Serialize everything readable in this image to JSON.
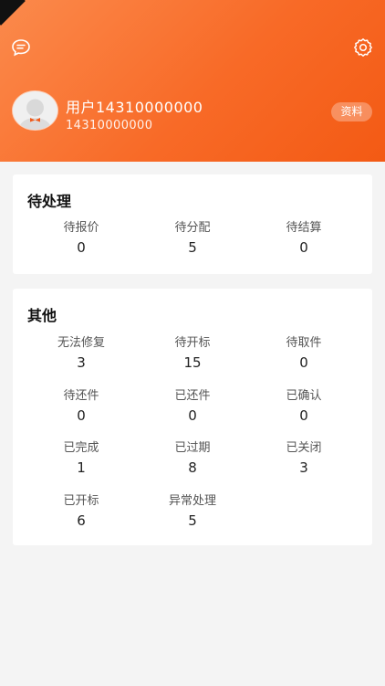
{
  "header": {
    "user_name": "用户14310000000",
    "user_phone": "14310000000",
    "profile_button": "资料"
  },
  "pending": {
    "title": "待处理",
    "stats": [
      {
        "label": "待报价",
        "value": "0"
      },
      {
        "label": "待分配",
        "value": "5"
      },
      {
        "label": "待结算",
        "value": "0"
      }
    ]
  },
  "other": {
    "title": "其他",
    "stats": [
      {
        "label": "无法修复",
        "value": "3"
      },
      {
        "label": "待开标",
        "value": "15"
      },
      {
        "label": "待取件",
        "value": "0"
      },
      {
        "label": "待还件",
        "value": "0"
      },
      {
        "label": "已还件",
        "value": "0"
      },
      {
        "label": "已确认",
        "value": "0"
      },
      {
        "label": "已完成",
        "value": "1"
      },
      {
        "label": "已过期",
        "value": "8"
      },
      {
        "label": "已关闭",
        "value": "3"
      },
      {
        "label": "已开标",
        "value": "6"
      },
      {
        "label": "异常处理",
        "value": "5"
      }
    ]
  },
  "colors": {
    "header_gradient_start": "#fb8a4c",
    "header_gradient_end": "#f35a14",
    "background": "#f4f4f4",
    "card": "#ffffff"
  },
  "icons": {
    "top_left": "chat-bubble-icon",
    "top_right": "gear-icon",
    "avatar": "user-avatar"
  }
}
